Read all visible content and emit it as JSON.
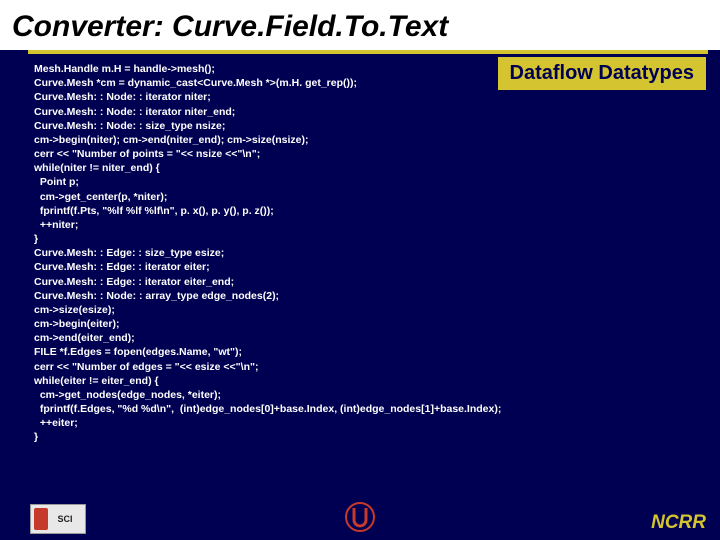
{
  "title": "Converter: Curve.Field.To.Text",
  "badge": "Dataflow Datatypes",
  "footer": {
    "sci_label": "SCI",
    "ncrr": "NCRR"
  },
  "code_lines": [
    "Mesh.Handle m.H = handle->mesh();",
    "Curve.Mesh *cm = dynamic_cast<Curve.Mesh *>(m.H. get_rep());",
    "Curve.Mesh: : Node: : iterator niter;",
    "Curve.Mesh: : Node: : iterator niter_end;",
    "Curve.Mesh: : Node: : size_type nsize;",
    "cm->begin(niter); cm->end(niter_end); cm->size(nsize);",
    "cerr << \"Number of points = \"<< nsize <<\"\\n\";",
    "while(niter != niter_end) {",
    "  Point p;",
    "  cm->get_center(p, *niter);",
    "  fprintf(f.Pts, \"%lf %lf %lf\\n\", p. x(), p. y(), p. z());",
    "  ++niter;",
    "}",
    "Curve.Mesh: : Edge: : size_type esize;",
    "Curve.Mesh: : Edge: : iterator eiter;",
    "Curve.Mesh: : Edge: : iterator eiter_end;",
    "Curve.Mesh: : Node: : array_type edge_nodes(2);",
    "cm->size(esize);",
    "cm->begin(eiter);",
    "cm->end(eiter_end);",
    "FILE *f.Edges = fopen(edges.Name, \"wt\");",
    "cerr << \"Number of edges = \"<< esize <<\"\\n\";",
    "while(eiter != eiter_end) {",
    "  cm->get_nodes(edge_nodes, *eiter);",
    "  fprintf(f.Edges, \"%d %d\\n\",  (int)edge_nodes[0]+base.Index, (int)edge_nodes[1]+base.Index);",
    "  ++eiter;",
    "}"
  ]
}
